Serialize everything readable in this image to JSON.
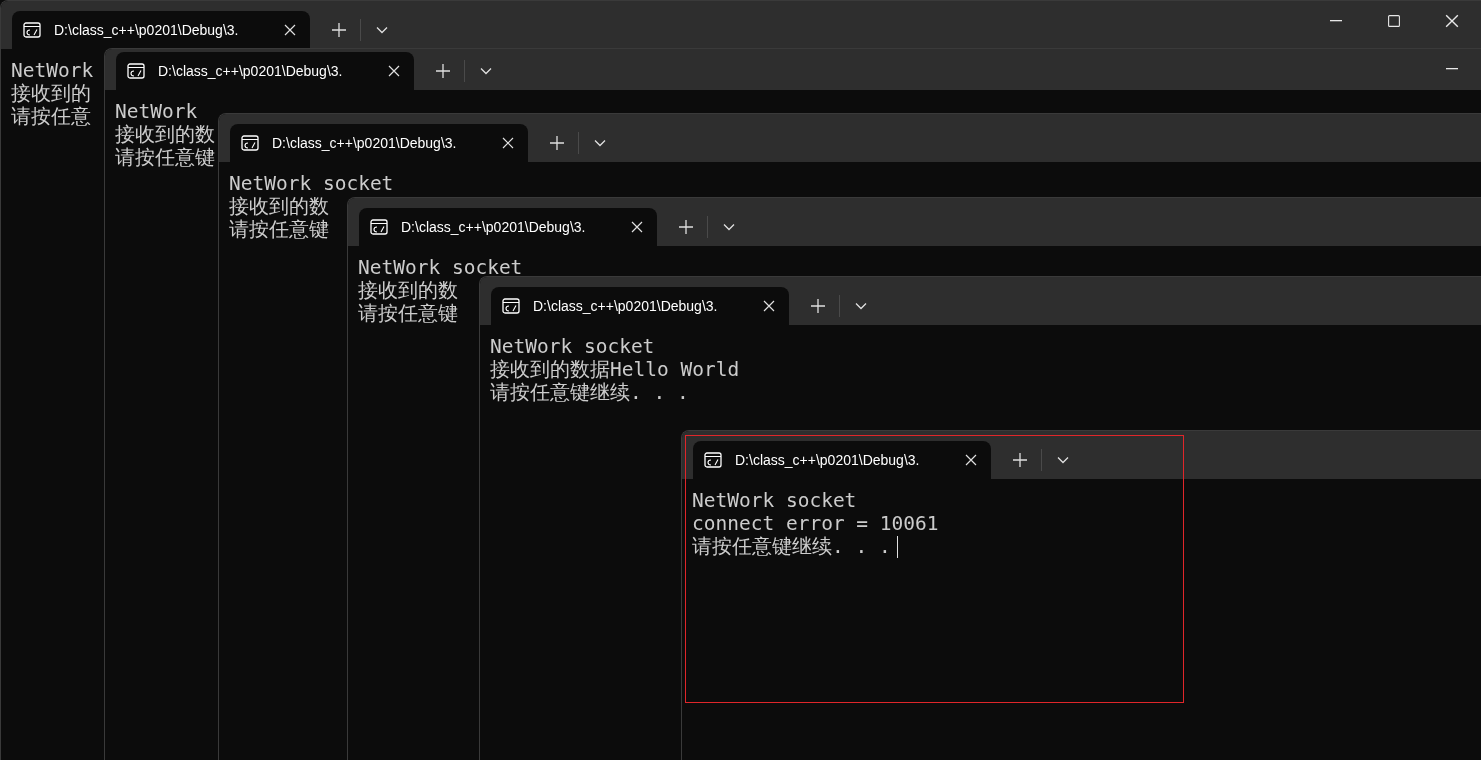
{
  "windows": [
    {
      "tab": {
        "title": "D:\\class_c++\\p0201\\Debug\\3.",
        "selected": true
      },
      "controls": [
        {
          "kind": "minimize"
        },
        {
          "kind": "maximize"
        },
        {
          "kind": "close"
        }
      ],
      "lines": [
        "NetWork",
        "接收到的",
        "请按任意"
      ]
    },
    {
      "tab": {
        "title": "D:\\class_c++\\p0201\\Debug\\3.",
        "selected": true
      },
      "controls": [
        {
          "kind": "minimize"
        }
      ],
      "lines": [
        "NetWork",
        "接收到的数",
        "请按任意键"
      ]
    },
    {
      "tab": {
        "title": "D:\\class_c++\\p0201\\Debug\\3.",
        "selected": true
      },
      "lines": [
        "NetWork socket",
        "接收到的数",
        "请按任意键"
      ]
    },
    {
      "tab": {
        "title": "D:\\class_c++\\p0201\\Debug\\3.",
        "selected": true
      },
      "lines": [
        "NetWork socket",
        "接收到的数",
        "请按任意键"
      ]
    },
    {
      "tab": {
        "title": "D:\\class_c++\\p0201\\Debug\\3.",
        "selected": true
      },
      "lines": [
        "NetWork socket",
        "接收到的数据Hello World",
        "请按任意键继续. . ."
      ]
    },
    {
      "tab": {
        "title": "D:\\class_c++\\p0201\\Debug\\3.",
        "selected": true
      },
      "lines": [
        "NetWork socket",
        "connect error = 10061",
        "请按任意键继续. . ."
      ],
      "cursor": true,
      "highlighted": true
    }
  ]
}
